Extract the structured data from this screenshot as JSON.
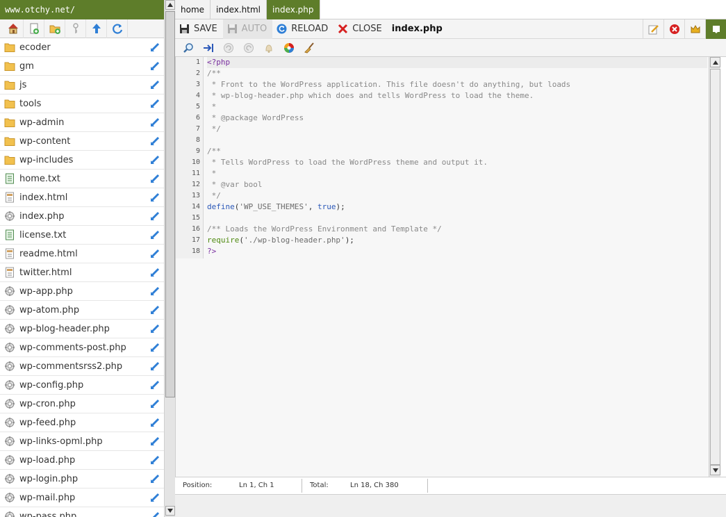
{
  "site": {
    "url": "www.otchy.net/"
  },
  "left_toolbar": {
    "icons": [
      "home-icon",
      "new-file-icon",
      "new-folder-icon",
      "key-icon",
      "upload-icon",
      "refresh-icon"
    ]
  },
  "files": [
    {
      "name": "ecoder",
      "type": "folder"
    },
    {
      "name": "gm",
      "type": "folder"
    },
    {
      "name": "js",
      "type": "folder"
    },
    {
      "name": "tools",
      "type": "folder"
    },
    {
      "name": "wp-admin",
      "type": "folder"
    },
    {
      "name": "wp-content",
      "type": "folder"
    },
    {
      "name": "wp-includes",
      "type": "folder"
    },
    {
      "name": "home.txt",
      "type": "text"
    },
    {
      "name": "index.html",
      "type": "html"
    },
    {
      "name": "index.php",
      "type": "php"
    },
    {
      "name": "license.txt",
      "type": "text"
    },
    {
      "name": "readme.html",
      "type": "html"
    },
    {
      "name": "twitter.html",
      "type": "html"
    },
    {
      "name": "wp-app.php",
      "type": "php"
    },
    {
      "name": "wp-atom.php",
      "type": "php"
    },
    {
      "name": "wp-blog-header.php",
      "type": "php"
    },
    {
      "name": "wp-comments-post.php",
      "type": "php"
    },
    {
      "name": "wp-commentsrss2.php",
      "type": "php"
    },
    {
      "name": "wp-config.php",
      "type": "php"
    },
    {
      "name": "wp-cron.php",
      "type": "php"
    },
    {
      "name": "wp-feed.php",
      "type": "php"
    },
    {
      "name": "wp-links-opml.php",
      "type": "php"
    },
    {
      "name": "wp-load.php",
      "type": "php"
    },
    {
      "name": "wp-login.php",
      "type": "php"
    },
    {
      "name": "wp-mail.php",
      "type": "php"
    },
    {
      "name": "wp-pass.php",
      "type": "php"
    }
  ],
  "tabs": [
    {
      "label": "home",
      "active": false
    },
    {
      "label": "index.html",
      "active": false
    },
    {
      "label": "index.php",
      "active": true
    }
  ],
  "toolbar": {
    "save_label": "SAVE",
    "auto_label": "AUTO",
    "reload_label": "RELOAD",
    "close_label": "CLOSE",
    "file_title": "index.php"
  },
  "editor": {
    "line_numbers": [
      "1",
      "2",
      "3",
      "4",
      "5",
      "6",
      "7",
      "8",
      "9",
      "10",
      "11",
      "12",
      "13",
      "14",
      "15",
      "16",
      "17",
      "18"
    ],
    "lines": [
      "<?php",
      "/**",
      " * Front to the WordPress application. This file doesn't do anything, but loads",
      " * wp-blog-header.php which does and tells WordPress to load the theme.",
      " *",
      " * @package WordPress",
      " */",
      "",
      "/**",
      " * Tells WordPress to load the WordPress theme and output it.",
      " *",
      " * @var bool",
      " */",
      "define('WP_USE_THEMES', true);",
      "",
      "/** Loads the WordPress Environment and Template */",
      "require('./wp-blog-header.php');",
      "?>"
    ]
  },
  "status": {
    "position_label": "Position:",
    "position_value": "Ln 1, Ch 1",
    "total_label": "Total:",
    "total_value": "Ln 18, Ch 380"
  },
  "colors": {
    "accent": "#5e7d2a",
    "keyword": "#2a57b8",
    "comment": "#888888"
  }
}
